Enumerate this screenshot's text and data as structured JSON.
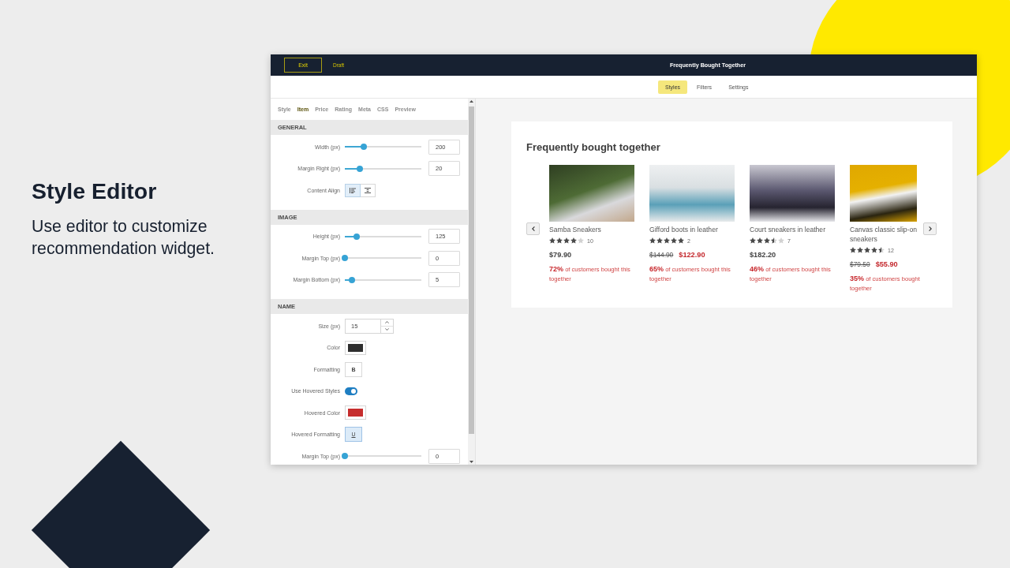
{
  "intro": {
    "title": "Style Editor",
    "description": "Use editor to customize recommendation widget."
  },
  "top_bar": {
    "exit_button": "Exit",
    "status": "Draft",
    "title": "Frequently Bought Together"
  },
  "tabs": [
    {
      "label": "Styles",
      "selected": true
    },
    {
      "label": "Filters",
      "selected": false
    },
    {
      "label": "Settings",
      "selected": false
    }
  ],
  "editor": {
    "subtabs": [
      {
        "label": "Style",
        "selected": false
      },
      {
        "label": "Item",
        "selected": true
      },
      {
        "label": "Price",
        "selected": false
      },
      {
        "label": "Rating",
        "selected": false
      },
      {
        "label": "Meta",
        "selected": false
      },
      {
        "label": "CSS",
        "selected": false
      },
      {
        "label": "Preview",
        "selected": false
      }
    ],
    "sections": [
      {
        "title": "GENERAL",
        "rows": [
          {
            "kind": "slider",
            "label": "Width (px)",
            "level": 0.25,
            "value": "200"
          },
          {
            "kind": "slider",
            "label": "Margin Right (px)",
            "level": 0.2,
            "value": "20"
          },
          {
            "kind": "align",
            "label": "Content Align",
            "options": [
              {
                "selected": true
              },
              {
                "selected": false
              }
            ]
          }
        ]
      },
      {
        "title": "IMAGE",
        "rows": [
          {
            "kind": "slider",
            "label": "Height (px)",
            "level": 0.15,
            "value": "125"
          },
          {
            "kind": "slider",
            "label": "Margin Top (px)",
            "level": 0,
            "value": "0"
          },
          {
            "kind": "slider",
            "label": "Margin Bottom (px)",
            "level": 0.09,
            "value": "5"
          }
        ]
      },
      {
        "title": "NAME",
        "rows": [
          {
            "kind": "number",
            "label": "Size (px)",
            "value": "15"
          },
          {
            "kind": "color",
            "label": "Color",
            "color": "#2e2e2e"
          },
          {
            "kind": "bold",
            "label": "Formatting",
            "button": "B",
            "selected": false
          },
          {
            "kind": "toggle",
            "label": "Use Hovered Styles",
            "on": true
          },
          {
            "kind": "color",
            "label": "Hovered Color",
            "color": "#c62d2d"
          },
          {
            "kind": "underline",
            "label": "Hovered Formatting",
            "button": "U",
            "selected": true
          },
          {
            "kind": "slider",
            "label": "Margin Top (px)",
            "level": 0,
            "value": "0"
          }
        ]
      }
    ]
  },
  "preview": {
    "title": "Frequently bought together",
    "products": [
      {
        "name": "Samba Sneakers",
        "stars": 4,
        "reviews": "10",
        "price": "$79.90",
        "note": "**72%** of customers bought this together"
      },
      {
        "name": "Gifford boots in leather",
        "stars": 5,
        "reviews": "2",
        "old_price": "$144.90",
        "price": "$122.90",
        "note": "**65%** of customers bought this together"
      },
      {
        "name": "Court sneakers in leather",
        "stars": 3.5,
        "reviews": "7",
        "price": "$182.20",
        "note": "**46%** of customers bought this together"
      },
      {
        "name": "Canvas classic slip-on sneakers",
        "stars": 4.5,
        "reviews": "12",
        "old_price": "$79.50",
        "price": "$55.90",
        "note": "**35%** of customers bought together"
      }
    ]
  }
}
